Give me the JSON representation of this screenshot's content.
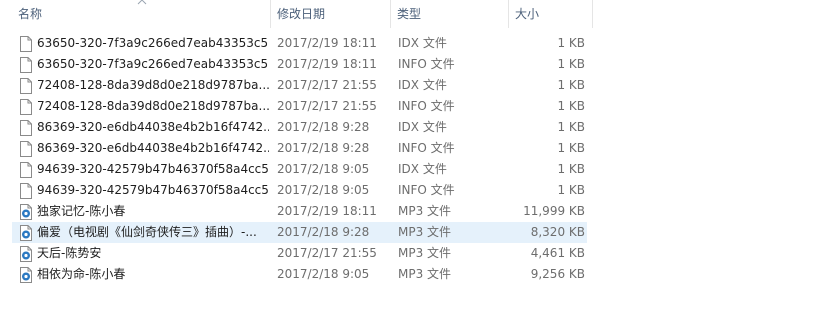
{
  "columns": {
    "name": "名称",
    "date": "修改日期",
    "type": "类型",
    "size": "大小"
  },
  "files": [
    {
      "name": "63650-320-7f3a9c266ed7eab43353c5...",
      "date": "2017/2/19 18:11",
      "type": "IDX 文件",
      "size": "1 KB",
      "icon": "blank-file-icon"
    },
    {
      "name": "63650-320-7f3a9c266ed7eab43353c5...",
      "date": "2017/2/19 18:11",
      "type": "INFO 文件",
      "size": "1 KB",
      "icon": "blank-file-icon"
    },
    {
      "name": "72408-128-8da39d8d0e218d9787ba...",
      "date": "2017/2/17 21:55",
      "type": "IDX 文件",
      "size": "1 KB",
      "icon": "blank-file-icon"
    },
    {
      "name": "72408-128-8da39d8d0e218d9787ba...",
      "date": "2017/2/17 21:55",
      "type": "INFO 文件",
      "size": "1 KB",
      "icon": "blank-file-icon"
    },
    {
      "name": "86369-320-e6db44038e4b2b16f4742...",
      "date": "2017/2/18 9:28",
      "type": "IDX 文件",
      "size": "1 KB",
      "icon": "blank-file-icon"
    },
    {
      "name": "86369-320-e6db44038e4b2b16f4742...",
      "date": "2017/2/18 9:28",
      "type": "INFO 文件",
      "size": "1 KB",
      "icon": "blank-file-icon"
    },
    {
      "name": "94639-320-42579b47b46370f58a4cc5...",
      "date": "2017/2/18 9:05",
      "type": "IDX 文件",
      "size": "1 KB",
      "icon": "blank-file-icon"
    },
    {
      "name": "94639-320-42579b47b46370f58a4cc5...",
      "date": "2017/2/18 9:05",
      "type": "INFO 文件",
      "size": "1 KB",
      "icon": "blank-file-icon"
    },
    {
      "name": "独家记忆-陈小春",
      "date": "2017/2/19 18:11",
      "type": "MP3 文件",
      "size": "11,999 KB",
      "icon": "audio-file-icon"
    },
    {
      "name": "偏爱（电视剧《仙剑奇侠传三》插曲）-...",
      "date": "2017/2/18 9:28",
      "type": "MP3 文件",
      "size": "8,320 KB",
      "icon": "audio-file-icon",
      "selected": true
    },
    {
      "name": "天后-陈势安",
      "date": "2017/2/17 21:55",
      "type": "MP3 文件",
      "size": "4,461 KB",
      "icon": "audio-file-icon"
    },
    {
      "name": "相依为命-陈小春",
      "date": "2017/2/18 9:05",
      "type": "MP3 文件",
      "size": "9,256 KB",
      "icon": "audio-file-icon"
    }
  ],
  "colors": {
    "header_text": "#4c607a",
    "selected_row": "#e5f1fb",
    "audio_icon": "#2b79c2"
  }
}
